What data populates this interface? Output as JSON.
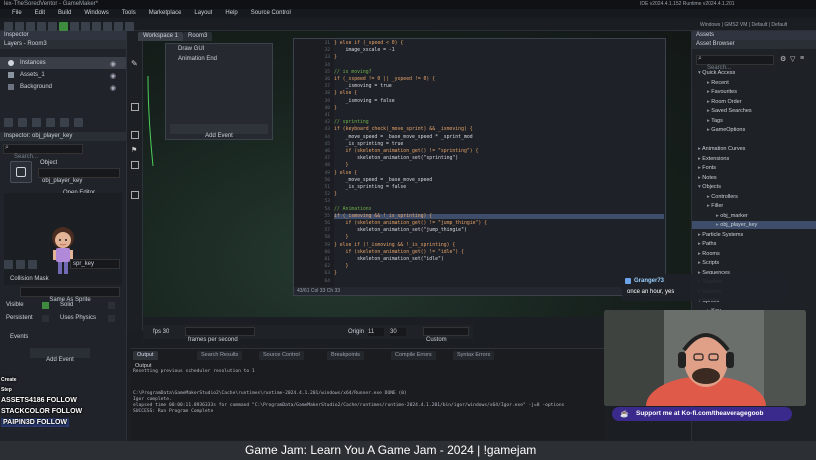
{
  "window": {
    "title": "lex-TheSoredVentor - GameMaker*",
    "ide_info": "IDE v2024.4.1.152  Runtime v2024.4.1.201",
    "device_info": "Windows | GMS2 VM | Default | Default"
  },
  "menu": [
    "File",
    "Edit",
    "Build",
    "Windows",
    "Tools",
    "Marketplace",
    "Layout",
    "Help",
    "Source Control"
  ],
  "inspector": {
    "tab": "Inspector",
    "layers_label": "Layers - Room3",
    "layers": [
      "Instances",
      "Assets_1",
      "Background"
    ],
    "obj_tab": "Inspector: obj_player_key",
    "search_placeholder": "Search...",
    "object_label": "Object",
    "object_name": "obj_player_key",
    "open_editor": "Open Editor",
    "sprite_name": "spr_key",
    "collision_mask": "Collision Mask",
    "same_as_sprite": "Same As Sprite",
    "visible": "Visible",
    "solid": "Solid",
    "persistent": "Persistent",
    "uses_physics": "Uses Physics",
    "events": "Events",
    "add_event": "Add Event"
  },
  "workspace": {
    "tabs": [
      "Workspace 1",
      "Room3"
    ],
    "event_list": [
      "Draw GUI",
      "Animation End"
    ],
    "add_event": "Add Event"
  },
  "code": {
    "lines": [
      {
        "n": "31",
        "t": "} else if (_speed < 0) {"
      },
      {
        "n": "32",
        "t": "    image_xscale = -1"
      },
      {
        "n": "33",
        "t": "}"
      },
      {
        "n": "34",
        "t": ""
      },
      {
        "n": "35",
        "t": "// is moving?"
      },
      {
        "n": "36",
        "t": "if (_xspeed != 0 || _yspeed != 0) {"
      },
      {
        "n": "37",
        "t": "    _ismoving = true"
      },
      {
        "n": "38",
        "t": "} else {"
      },
      {
        "n": "39",
        "t": "    _ismoving = false"
      },
      {
        "n": "40",
        "t": "}"
      },
      {
        "n": "41",
        "t": ""
      },
      {
        "n": "42",
        "t": "// sprinting"
      },
      {
        "n": "43",
        "t": "if (keyboard_check(_move_sprint) && _ismoving) {"
      },
      {
        "n": "44",
        "t": "    _move_speed = _base_move_speed * _sprint_mod"
      },
      {
        "n": "45",
        "t": "    _is_sprinting = true"
      },
      {
        "n": "46",
        "t": "    if (skeleton_animation_get() != \"sprinting\") {"
      },
      {
        "n": "47",
        "t": "        skeleton_animation_set(\"sprinting\")"
      },
      {
        "n": "48",
        "t": "    }"
      },
      {
        "n": "49",
        "t": "} else {"
      },
      {
        "n": "50",
        "t": "    _move_speed = _base_move_speed"
      },
      {
        "n": "51",
        "t": "    _is_sprinting = false"
      },
      {
        "n": "52",
        "t": "}"
      },
      {
        "n": "53",
        "t": ""
      },
      {
        "n": "54",
        "t": "// Animations"
      },
      {
        "n": "55",
        "t": "if (_ismoving && !_is_sprinting) {"
      },
      {
        "n": "56",
        "t": "    if (skeleton_animation_get() != \"jump_thingie\") {"
      },
      {
        "n": "57",
        "t": "        skeleton_animation_set(\"jump_thingie\")"
      },
      {
        "n": "58",
        "t": "    }"
      },
      {
        "n": "59",
        "t": "} else if (!_ismoving && !_is_sprinting) {"
      },
      {
        "n": "60",
        "t": "    if (skeleton_animation_get() != \"idle\") {"
      },
      {
        "n": "61",
        "t": "        skeleton_animation_set(\"idle\")"
      },
      {
        "n": "62",
        "t": "    }"
      },
      {
        "n": "63",
        "t": "}"
      },
      {
        "n": "64",
        "t": ""
      }
    ],
    "status": "43/61 Col 33 Ch 33"
  },
  "props": {
    "fps_label": "fps 30",
    "frames_label": "frames per second",
    "origin_label": "Origin",
    "origin_x": "11",
    "origin_y": "30",
    "origin_mode": "Custom"
  },
  "output": {
    "tabs": [
      "Output",
      "Search Results",
      "Source Control",
      "Breakpoints",
      "Compile Errors",
      "Syntax Errors"
    ],
    "header": "Output",
    "lines": [
      "Resetting previous scheduler resolution to 1",
      "",
      "C:\\ProgramData\\GameMakerStudio2\\Cache\\runtimes\\runtime-2024.4.1.201/windows/x64/Runner.exe DONE (0)",
      "Igor complete.",
      "elapsed time 00:00:11.8936333s for command \"C:\\ProgramData/GameMakerStudio2/Cache/runtimes/runtime-2024.4.1.201/bin/igor/windows/x64/Igor.exe\" -j=8 -options",
      "SUCCESS: Run Program Complete"
    ]
  },
  "assets": {
    "tab": "Assets",
    "browser": "Asset Browser",
    "search_placeholder": "Search...",
    "rows": [
      {
        "label": "Quick Access",
        "indent": 0,
        "open": true,
        "sel": false
      },
      {
        "label": "Recent",
        "indent": 1,
        "sel": false
      },
      {
        "label": "Favourites",
        "indent": 1,
        "sel": false
      },
      {
        "label": "Room Order",
        "indent": 1,
        "sel": false
      },
      {
        "label": "Saved Searches",
        "indent": 1,
        "sel": false
      },
      {
        "label": "Tags",
        "indent": 1,
        "sel": false
      },
      {
        "label": "GameOptions",
        "indent": 1,
        "sel": false
      },
      {
        "label": "",
        "indent": 0,
        "sel": false
      },
      {
        "label": "Animation Curves",
        "indent": 0,
        "sel": false
      },
      {
        "label": "Extensions",
        "indent": 0,
        "sel": false
      },
      {
        "label": "Fonts",
        "indent": 0,
        "sel": false
      },
      {
        "label": "Notes",
        "indent": 0,
        "sel": false
      },
      {
        "label": "Objects",
        "indent": 0,
        "open": true,
        "sel": false
      },
      {
        "label": "Controllers",
        "indent": 1,
        "sel": false
      },
      {
        "label": "Filler",
        "indent": 1,
        "sel": false
      },
      {
        "label": "obj_marker",
        "indent": 2,
        "sel": false
      },
      {
        "label": "obj_player_key",
        "indent": 2,
        "sel": true
      },
      {
        "label": "Particle Systems",
        "indent": 0,
        "sel": false
      },
      {
        "label": "Paths",
        "indent": 0,
        "sel": false
      },
      {
        "label": "Rooms",
        "indent": 0,
        "sel": false
      },
      {
        "label": "Scripts",
        "indent": 0,
        "sel": false
      },
      {
        "label": "Sequences",
        "indent": 0,
        "sel": false
      },
      {
        "label": "Shaders",
        "indent": 0,
        "sel": false
      },
      {
        "label": "Sounds",
        "indent": 0,
        "sel": false
      },
      {
        "label": "Sprites",
        "indent": 0,
        "open": true,
        "sel": false
      },
      {
        "label": "Key",
        "indent": 1,
        "sel": false
      },
      {
        "label": "spr_key",
        "indent": 2,
        "sel": false
      }
    ]
  },
  "chat": {
    "user": "Granger73",
    "message": "once an hour, yes"
  },
  "kofi": "Support me at Ko-fi.com/theaveragegoob",
  "stream_title": "Game Jam: Learn You A Game Jam - 2024 | !gamejam",
  "overlay_names": [
    "Create",
    "Step",
    "ASSETS4186 FOLLOW",
    "STACKCOLOR FOLLOW",
    "PAIPIN3D FOLLOW"
  ],
  "colors": {
    "keyword": "#e8a46a",
    "string": "#e6db74",
    "comment": "#6fb04c",
    "plain": "#d9dde2",
    "selected": "#3e4d6a",
    "accent": "#5a8fd8"
  }
}
